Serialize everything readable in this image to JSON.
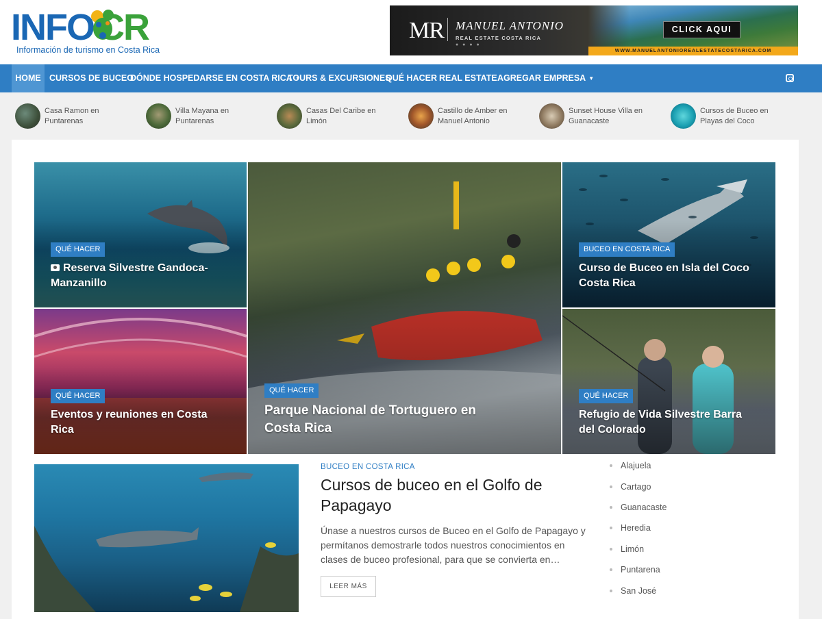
{
  "header": {
    "logo": {
      "word_a": "INFO",
      "word_b": "CR",
      "tagline": "Información de turismo en Costa Rica"
    },
    "banner": {
      "monogram": "MR",
      "brand": "MANUEL ANTONIO",
      "subtitle": "REAL ESTATE COSTA RICA",
      "dots": "● ● ● ●",
      "cta": "CLICK AQUI",
      "url": "WWW.MANUELANTONIOREALESTATECOSTARICA.COM"
    }
  },
  "nav": {
    "items": [
      {
        "label": "HOME",
        "active": true
      },
      {
        "label": "CURSOS DE BUCEO"
      },
      {
        "label": "DÓNDE HOSPEDARSE EN COSTA RICA",
        "caret": "▼"
      },
      {
        "label": "TOURS & EXCURSIONES"
      },
      {
        "label": "QUÉ HACER"
      },
      {
        "label": "REAL ESTATE"
      },
      {
        "label": "AGREGAR EMPRESA",
        "caret": "▼"
      }
    ],
    "social_icon": "instagram-icon"
  },
  "featured": [
    {
      "label": "Casa Ramon en Puntarenas"
    },
    {
      "label": "Villa Mayana en Puntarenas"
    },
    {
      "label": "Casas Del Caribe en Limón"
    },
    {
      "label": "Castillo de Amber en Manuel Antonio"
    },
    {
      "label": "Sunset House Villa en Guanacaste"
    },
    {
      "label": "Cursos de Buceo en Playas del Coco"
    }
  ],
  "grid": {
    "dolphin": {
      "category": "QUÉ HACER",
      "title": "Reserva Silvestre Gandoca-Manzanillo",
      "icon": "camera-icon"
    },
    "ballroom": {
      "category": "QUÉ HACER",
      "title": "Eventos y reuniones en Costa Rica"
    },
    "rafting": {
      "category": "QUÉ HACER",
      "title": "Parque Nacional de Tortuguero en Costa Rica"
    },
    "hammerhead": {
      "category": "BUCEO EN COSTA RICA",
      "title": "Curso de Buceo en Isla del Coco Costa Rica"
    },
    "fishing": {
      "category": "QUÉ HACER",
      "title": "Refugio de Vida Silvestre Barra del Colorado"
    }
  },
  "post": {
    "category": "BUCEO EN COSTA RICA",
    "title": "Cursos de buceo en el Golfo de Papagayo",
    "excerpt": "Únase a nuestros cursos de Buceo en el Golfo de Papagayo y permítanos demostrarle todos nuestros conocimientos en clases de buceo profesional, para que se convierta en…",
    "read_more": "LEER MÁS"
  },
  "sidebar": {
    "provinces": [
      "Alajuela",
      "Cartago",
      "Guanacaste",
      "Heredia",
      "Limón",
      "Puntarena",
      "San José"
    ]
  }
}
